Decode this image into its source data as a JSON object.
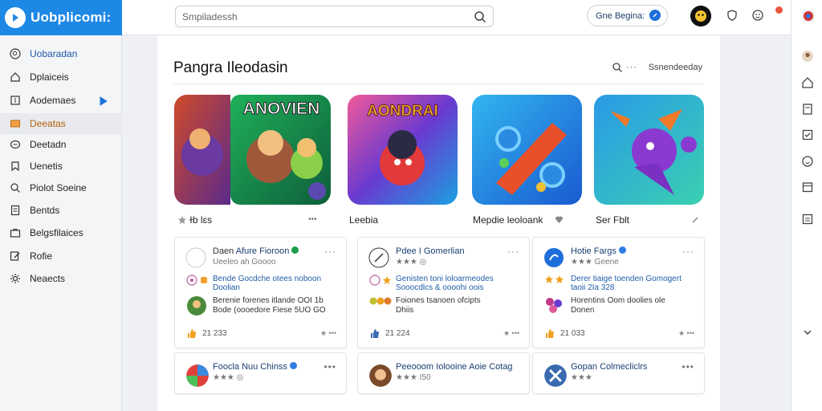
{
  "app": {
    "name": "Uobplicomi:",
    "search_placeholder": "Smpiladessh",
    "region_label": "Gne Begina:"
  },
  "sidebar": {
    "items": [
      {
        "label": "Uobaradan",
        "icon": "search-circle-icon"
      },
      {
        "label": "Dplaiceis",
        "icon": "home-icon"
      },
      {
        "label": "Aodemaes",
        "icon": "square-icon"
      },
      {
        "label": "Deeatas",
        "icon": "folder-icon"
      },
      {
        "label": "Deetadn",
        "icon": "chat-icon"
      },
      {
        "label": "Uenetis",
        "icon": "bookmark-icon"
      },
      {
        "label": "Piolot Soeine",
        "icon": "search-icon"
      },
      {
        "label": "Bentds",
        "icon": "document-icon"
      },
      {
        "label": "Belgsfilaices",
        "icon": "briefcase-icon"
      },
      {
        "label": "Rofie",
        "icon": "edit-icon"
      },
      {
        "label": "Neaects",
        "icon": "gear-icon"
      }
    ]
  },
  "main": {
    "title": "Pangra Ileodasin",
    "sort_label": "Ssnendeeday",
    "featured": [
      {
        "name": "Ƒ    ɩ ɦ ɫɛs",
        "shown_name": "ɫb Ɩɛs",
        "extra": "•••",
        "banner": "ANOVIEN"
      },
      {
        "name": "Leebia",
        "banner": "AONDRAI"
      },
      {
        "name": "Mepdie leoloank",
        "banner": ""
      },
      {
        "name": "Ser Fblt",
        "banner": ""
      }
    ],
    "cards": [
      {
        "title_pre": "Daen",
        "title": "Afure Fioroon",
        "sub": "Ueeleo ah Goooo",
        "line1a": "Bende Gocdche otees noboon",
        "line1b": "Doolian",
        "line2a": "Berenie forenes itlande OOI 1b",
        "line2b": "Bode (oooedore Fiese 5UO GO",
        "stat": "21 233",
        "right": "★ •••"
      },
      {
        "title_pre": "",
        "title": "Pdee I Gomerlian",
        "sub": "★★★ ◎",
        "line1a": "Genisten toni loloarmeodes",
        "line1b": "Sooocdlcs & oooohi oois",
        "line2a": "Foiones tsanoen ofcipts",
        "line2b": "Dhiis",
        "stat": "21 224",
        "right": "★ •••"
      },
      {
        "title_pre": "",
        "title": "Hotie Fargs",
        "sub": "★★★ Geene",
        "line1a": "Derer tiaige toenden Gomogert",
        "line1b": "taoii 2Ia 328",
        "line2a": "Horentins Oom doolies ole",
        "line2b": "Donen",
        "stat": "21 033",
        "right": "★ •••"
      },
      {
        "title_pre": "",
        "title": "Foocla Nuu Chinss",
        "sub": "★★★ ◎",
        "right": "•••"
      },
      {
        "title_pre": "",
        "title": "Peeooom Iolooine Aoie Cotag",
        "sub": "★★★ I50",
        "right": ""
      },
      {
        "title_pre": "",
        "title": "Gopan Colmecliclrs",
        "sub": "★★★",
        "right": "•••"
      }
    ]
  },
  "colors": {
    "brand": "#1e88e5",
    "active_nav_text": "#b8610f",
    "link": "#1f5ea8",
    "notification": "#e8563b"
  }
}
